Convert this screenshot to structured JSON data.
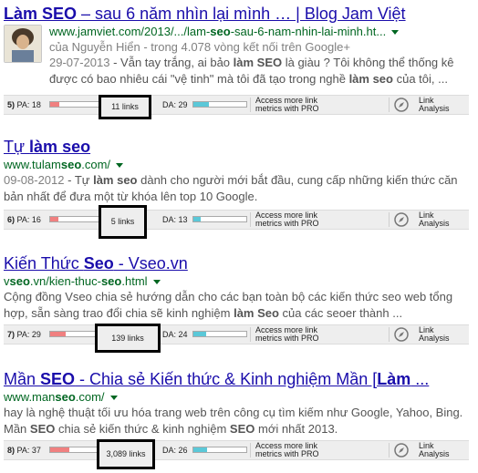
{
  "results": [
    {
      "title_pre": "",
      "title_bold": "Làm SEO",
      "title_post": " – sau 6 năm nhìn lại mình … | Blog Jam Việt",
      "url_pre": "www.jamviet.com/2013/.../lam-",
      "url_bold": "seo",
      "url_post": "-sau-6-nam-nhin-lai-minh.ht...",
      "byline": "của Nguyễn Hiển - trong 4.078 vòng kết nối trên Google+",
      "date": "29-07-2013",
      "snippet_parts": [
        {
          "t": " - Vẫn tay trắng, ai bảo "
        },
        {
          "t": "làm SEO",
          "b": true
        },
        {
          "t": " là giàu ? Tôi không thể thống kê được có bao nhiêu cái \"vệ tinh\" mà tôi đã tạo trong nghề "
        },
        {
          "t": "làm seo",
          "b": true
        },
        {
          "t": " của tôi, ..."
        }
      ],
      "moz": {
        "rank": "5)",
        "pa": "PA: 18",
        "pa_value": 18,
        "links": "11 links",
        "da": "DA: 29",
        "da_value": 29,
        "pro_line1": "Access more link",
        "pro_line2": "metrics with PRO",
        "la_line1": "Link",
        "la_line2": "Analysis"
      }
    },
    {
      "title_pre": "Tự ",
      "title_bold": "làm seo",
      "title_post": "",
      "url_pre": "www.tulam",
      "url_bold": "seo",
      "url_post": ".com/",
      "date": "09-08-2012",
      "snippet_parts": [
        {
          "t": " - Tự "
        },
        {
          "t": "làm seo",
          "b": true
        },
        {
          "t": " dành cho người mới bắt đầu, cung cấp những kiến thức căn bản nhất để đưa một từ khóa lên top 10 Google."
        }
      ],
      "moz": {
        "rank": "6)",
        "pa": "PA: 16",
        "pa_value": 16,
        "links": "5 links",
        "da": "DA: 13",
        "da_value": 13,
        "pro_line1": "Access more link",
        "pro_line2": "metrics with PRO",
        "la_line1": "Link",
        "la_line2": "Analysis"
      }
    },
    {
      "title_pre": "Kiến Thức ",
      "title_bold": "Seo",
      "title_post": " - Vseo.vn",
      "url_pre": "v",
      "url_bold": "seo",
      "url_post": ".vn/kien-thuc-",
      "url_bold2": "seo",
      "url_post2": ".html",
      "snippet_parts": [
        {
          "t": "Cộng đồng Vseo chia sẻ hướng dẫn cho các bạn toàn bộ các kiến thức seo web tổng hợp, sẵn sàng trao đổi chia sẽ kinh nghiệm "
        },
        {
          "t": "làm Seo",
          "b": true
        },
        {
          "t": " của các seoer thành ..."
        }
      ],
      "moz": {
        "rank": "7)",
        "pa": "PA: 29",
        "pa_value": 29,
        "links": "139 links",
        "da": "DA: 24",
        "da_value": 24,
        "pro_line1": "Access more link",
        "pro_line2": "metrics with PRO",
        "la_line1": "Link",
        "la_line2": "Analysis"
      }
    },
    {
      "title_pre": "Mần ",
      "title_bold": "SEO",
      "title_post": " - Chia sẻ Kiến thức & Kinh nghiệm Mần [",
      "title_bold2": "Làm",
      "title_post2": " ...",
      "url_pre": "www.man",
      "url_bold": "seo",
      "url_post": ".com/",
      "snippet_parts": [
        {
          "t": "hay là nghệ thuật tối ưu hóa trang web trên công cụ tìm kiếm như Google, Yahoo, Bing. Mần "
        },
        {
          "t": "SEO",
          "b": true
        },
        {
          "t": " chia sẻ kiến thức & kinh nghiệm "
        },
        {
          "t": "SEO",
          "b": true
        },
        {
          "t": " mới nhất 2013."
        }
      ],
      "moz": {
        "rank": "8)",
        "pa": "PA: 37",
        "pa_value": 37,
        "links": "3,089 links",
        "da": "DA: 26",
        "da_value": 26,
        "pro_line1": "Access more link",
        "pro_line2": "metrics with PRO",
        "la_line1": "Link",
        "la_line2": "Analysis"
      }
    }
  ],
  "colors": {
    "title": "#1a0dab",
    "url": "#006621",
    "snippet": "#545454",
    "pa_bar": "#f08080",
    "da_bar": "#5bc8d8"
  },
  "icons": {
    "compass": "compass-icon",
    "dropdown": "dropdown-caret-icon",
    "avatar": "author-avatar"
  }
}
